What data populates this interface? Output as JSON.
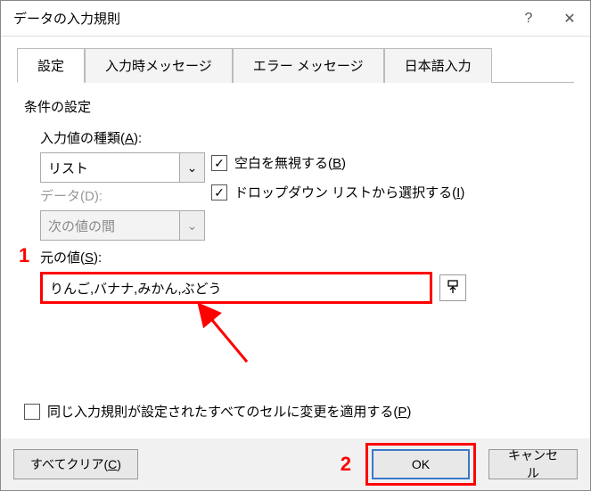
{
  "window": {
    "title": "データの入力規則"
  },
  "titlebar": {
    "help_icon": "?",
    "close_icon": "✕"
  },
  "tabs": {
    "settings": "設定",
    "input_msg": "入力時メッセージ",
    "error_msg": "エラー メッセージ",
    "ime": "日本語入力"
  },
  "section": {
    "title": "条件の設定"
  },
  "allow": {
    "label_pre": "入力値の種類(",
    "label_key": "A",
    "label_post": "):",
    "value": "リスト"
  },
  "data_field": {
    "label_pre": "データ(D):",
    "value": "次の値の間"
  },
  "checks": {
    "ignore_blank_pre": "空白を無視する(",
    "ignore_blank_key": "B",
    "ignore_blank_post": ")",
    "dropdown_pre": "ドロップダウン リストから選択する(",
    "dropdown_key": "I",
    "dropdown_post": ")"
  },
  "source": {
    "label_pre": "元の値(",
    "label_key": "S",
    "label_post": "):",
    "value": "りんご,バナナ,みかん,ぶどう"
  },
  "apply": {
    "label_pre": "同じ入力規則が設定されたすべてのセルに変更を適用する(",
    "label_key": "P",
    "label_post": ")"
  },
  "buttons": {
    "clear_pre": "すべてクリア(",
    "clear_key": "C",
    "clear_post": ")",
    "ok": "OK",
    "cancel": "キャンセル"
  },
  "annotations": {
    "one": "1",
    "two": "2"
  },
  "glyphs": {
    "check": "✓",
    "chevron": "⌄",
    "range": "⬆"
  }
}
